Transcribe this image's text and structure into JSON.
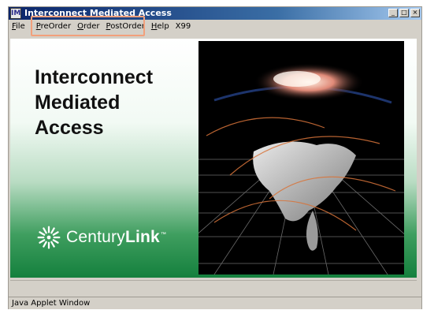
{
  "window": {
    "title": "Interconnect Mediated Access",
    "icon_name": "java-app-icon",
    "icon_glyph": "IM",
    "controls": {
      "minimize": "_",
      "maximize": "□",
      "close": "×"
    }
  },
  "menu": {
    "items": [
      {
        "key": "file",
        "underline": "F",
        "rest": "ile"
      },
      {
        "key": "preorder",
        "underline": "P",
        "rest": "reOrder"
      },
      {
        "key": "order",
        "underline": "O",
        "rest": "rder"
      },
      {
        "key": "postorder",
        "underline": "P",
        "rest": "ostOrder"
      },
      {
        "key": "help",
        "underline": "H",
        "rest": "elp"
      },
      {
        "key": "x99",
        "underline": "",
        "rest": "X99"
      }
    ],
    "highlighted": [
      "preorder",
      "order",
      "postorder"
    ],
    "highlight_color": "#f2a07b"
  },
  "banner": {
    "headline": [
      "Interconnect",
      "Mediated",
      "Access"
    ],
    "logo": {
      "brand_light": "Century",
      "brand_bold": "Link",
      "tm": "™"
    },
    "colors": {
      "green_dark": "#14803d",
      "green_light": "#b9dcc3"
    }
  },
  "footer": {
    "applet_label": "Java Applet Window"
  }
}
